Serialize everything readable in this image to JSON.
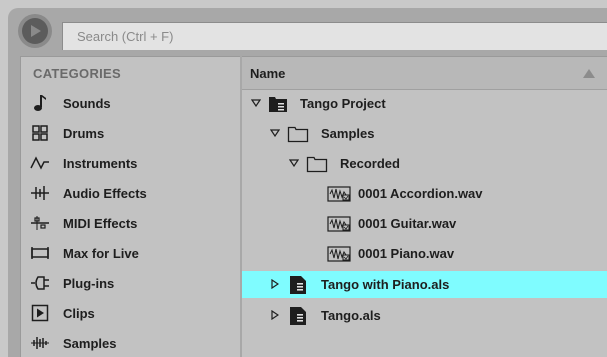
{
  "search": {
    "placeholder": "Search (Ctrl + F)"
  },
  "categories": {
    "title": "CATEGORIES",
    "items": [
      {
        "label": "Sounds",
        "icon": "note-icon"
      },
      {
        "label": "Drums",
        "icon": "drum-grid-icon"
      },
      {
        "label": "Instruments",
        "icon": "waveform-icon"
      },
      {
        "label": "Audio Effects",
        "icon": "audio-effects-icon"
      },
      {
        "label": "MIDI Effects",
        "icon": "midi-effects-icon"
      },
      {
        "label": "Max for Live",
        "icon": "max-for-live-icon"
      },
      {
        "label": "Plug-ins",
        "icon": "plugin-icon"
      },
      {
        "label": "Clips",
        "icon": "clip-icon"
      },
      {
        "label": "Samples",
        "icon": "sample-waveform-icon"
      }
    ]
  },
  "files": {
    "header": "Name",
    "rows": [
      {
        "label": "Tango Project",
        "type": "project",
        "expanded": true,
        "selected": false
      },
      {
        "label": "Samples",
        "type": "folder",
        "expanded": true,
        "selected": false
      },
      {
        "label": "Recorded",
        "type": "folder",
        "expanded": true,
        "selected": false
      },
      {
        "label": "0001 Accordion.wav",
        "type": "audio",
        "selected": false
      },
      {
        "label": "0001 Guitar.wav",
        "type": "audio",
        "selected": false
      },
      {
        "label": "0001 Piano.wav",
        "type": "audio",
        "selected": false
      },
      {
        "label": "Tango with Piano.als",
        "type": "set",
        "expanded": false,
        "selected": true
      },
      {
        "label": "Tango.als",
        "type": "set",
        "expanded": false,
        "selected": false
      }
    ]
  },
  "colors": {
    "selection": "#7ffcff",
    "panel": "#c2c2c2",
    "frame": "#a8a8a8"
  }
}
